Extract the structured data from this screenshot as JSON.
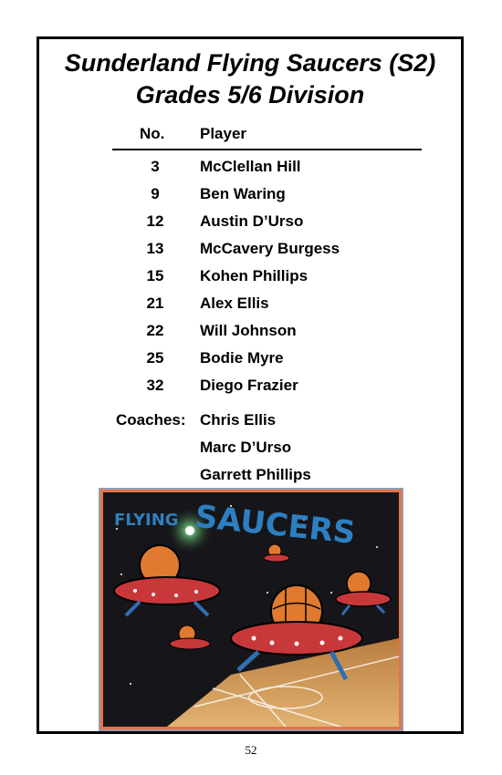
{
  "team_title": "Sunderland Flying Saucers (S2)",
  "division": "Grades 5/6 Division",
  "headers": {
    "number": "No.",
    "player": "Player"
  },
  "roster": [
    {
      "number": "3",
      "name": "McClellan Hill"
    },
    {
      "number": "9",
      "name": "Ben Waring"
    },
    {
      "number": "12",
      "name": "Austin D’Urso"
    },
    {
      "number": "13",
      "name": "McCavery Burgess"
    },
    {
      "number": "15",
      "name": "Kohen Phillips"
    },
    {
      "number": "21",
      "name": "Alex Ellis"
    },
    {
      "number": "22",
      "name": "Will Johnson"
    },
    {
      "number": "25",
      "name": "Bodie Myre"
    },
    {
      "number": "32",
      "name": "Diego Frazier"
    }
  ],
  "coaches_label": "Coaches:",
  "coaches": [
    "Chris Ellis",
    "Marc D’Urso",
    "Garrett Phillips"
  ],
  "logo": {
    "text": "FLYING SAUCERS",
    "colors": {
      "background": "#16161a",
      "border": "#e4734a",
      "text": "#2e7fc1",
      "saucer": "#c8383a",
      "ball": "#e07a30",
      "court": "#d9a25c"
    }
  },
  "page_number": "52"
}
